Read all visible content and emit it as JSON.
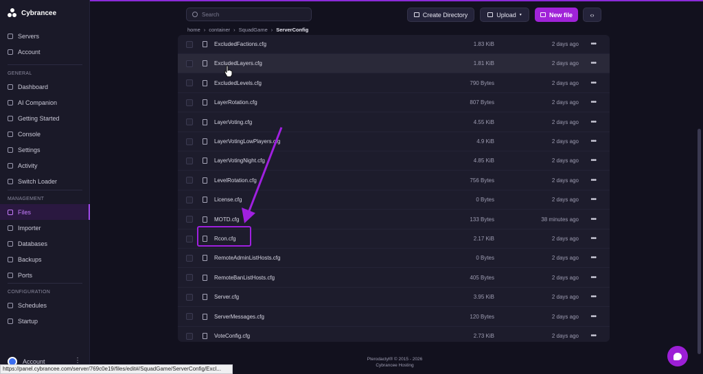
{
  "app": {
    "name": "Cybrancee"
  },
  "sidebar": {
    "top_items": [
      {
        "label": "Servers",
        "icon": "server-icon"
      },
      {
        "label": "Account",
        "icon": "account-icon"
      }
    ],
    "sections": [
      {
        "title": "GENERAL",
        "items": [
          {
            "label": "Dashboard",
            "icon": "dashboard-icon"
          },
          {
            "label": "AI Companion",
            "icon": "ai-icon"
          },
          {
            "label": "Getting Started",
            "icon": "lightbulb-icon"
          },
          {
            "label": "Console",
            "icon": "console-icon"
          },
          {
            "label": "Settings",
            "icon": "gear-icon"
          },
          {
            "label": "Activity",
            "icon": "eye-icon"
          },
          {
            "label": "Switch Loader",
            "icon": "switch-icon"
          }
        ]
      },
      {
        "title": "MANAGEMENT",
        "items": [
          {
            "label": "Files",
            "icon": "folder-icon",
            "active": true
          },
          {
            "label": "Importer",
            "icon": "import-icon"
          },
          {
            "label": "Databases",
            "icon": "database-icon"
          },
          {
            "label": "Backups",
            "icon": "backup-icon"
          },
          {
            "label": "Ports",
            "icon": "ports-icon"
          }
        ]
      },
      {
        "title": "CONFIGURATION",
        "items": [
          {
            "label": "Schedules",
            "icon": "calendar-icon"
          },
          {
            "label": "Startup",
            "icon": "startup-icon"
          }
        ]
      }
    ],
    "account_label": "Account"
  },
  "toolbar": {
    "search_placeholder": "Search",
    "create_directory": "Create Directory",
    "upload": "Upload",
    "new_file": "New file"
  },
  "breadcrumb": [
    "home",
    "container",
    "SquadGame",
    "ServerConfig"
  ],
  "files": [
    {
      "name": "ExcludedFactions.cfg",
      "size": "1.83 KiB",
      "modified": "2 days ago"
    },
    {
      "name": "ExcludedLayers.cfg",
      "size": "1.81 KiB",
      "modified": "2 days ago",
      "hover": true
    },
    {
      "name": "ExcludedLevels.cfg",
      "size": "790 Bytes",
      "modified": "2 days ago"
    },
    {
      "name": "LayerRotation.cfg",
      "size": "807 Bytes",
      "modified": "2 days ago"
    },
    {
      "name": "LayerVoting.cfg",
      "size": "4.55 KiB",
      "modified": "2 days ago"
    },
    {
      "name": "LayerVotingLowPlayers.cfg",
      "size": "4.9 KiB",
      "modified": "2 days ago"
    },
    {
      "name": "LayerVotingNight.cfg",
      "size": "4.85 KiB",
      "modified": "2 days ago"
    },
    {
      "name": "LevelRotation.cfg",
      "size": "756 Bytes",
      "modified": "2 days ago"
    },
    {
      "name": "License.cfg",
      "size": "0 Bytes",
      "modified": "2 days ago"
    },
    {
      "name": "MOTD.cfg",
      "size": "133 Bytes",
      "modified": "38 minutes ago"
    },
    {
      "name": "Rcon.cfg",
      "size": "2.17 KiB",
      "modified": "2 days ago"
    },
    {
      "name": "RemoteAdminListHosts.cfg",
      "size": "0 Bytes",
      "modified": "2 days ago"
    },
    {
      "name": "RemoteBanListHosts.cfg",
      "size": "405 Bytes",
      "modified": "2 days ago"
    },
    {
      "name": "Server.cfg",
      "size": "3.95 KiB",
      "modified": "2 days ago"
    },
    {
      "name": "ServerMessages.cfg",
      "size": "120 Bytes",
      "modified": "2 days ago"
    },
    {
      "name": "VoteConfig.cfg",
      "size": "2.73 KiB",
      "modified": "2 days ago"
    }
  ],
  "footer": {
    "line1": "Pterodactyl® © 2015 - 2026",
    "line2": "Cybrancee Hosting"
  },
  "status_url": "https://panel.cybrancee.com/server/769c0e19/files/edit#/SquadGame/ServerConfig/Excl...",
  "colors": {
    "accent": "#a023d8",
    "annotation": "#a020e0"
  }
}
